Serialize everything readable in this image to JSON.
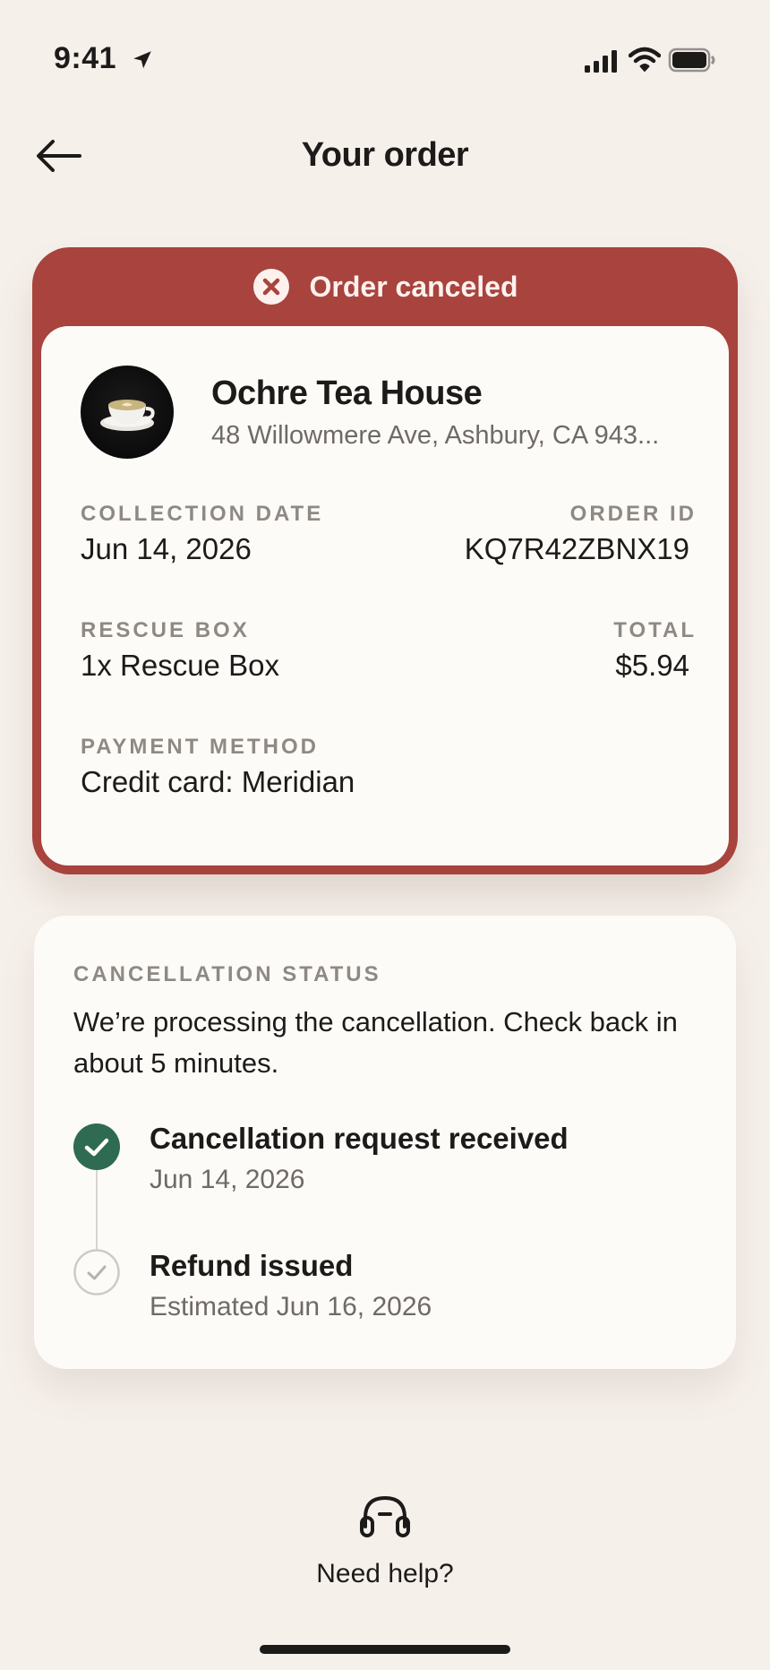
{
  "status_bar": {
    "time": "9:41",
    "icons": [
      "location-arrow-icon",
      "cellular-signal-icon",
      "wifi-icon",
      "battery-icon"
    ]
  },
  "header": {
    "title": "Your order",
    "back_icon": "arrow-left-icon"
  },
  "order": {
    "banner": {
      "icon": "x-circle-icon",
      "text": "Order canceled",
      "color": "#a8433d"
    },
    "store": {
      "name": "Ochre Tea House",
      "address": "48 Willowmere Ave, Ashbury, CA 943..."
    },
    "collection_date": {
      "label": "COLLECTION DATE",
      "value": "Jun 14, 2026"
    },
    "order_id": {
      "label": "ORDER ID",
      "value": "KQ7R42ZBNX19"
    },
    "rescue_box": {
      "label": "RESCUE BOX",
      "value": "1x Rescue Box"
    },
    "total": {
      "label": "TOTAL",
      "value": "$5.94"
    },
    "payment_method": {
      "label": "PAYMENT METHOD",
      "value": "Credit card: Meridian"
    }
  },
  "cancellation": {
    "label": "CANCELLATION STATUS",
    "message": "We’re processing the cancellation. Check back in about 5 minutes.",
    "steps": [
      {
        "title": "Cancellation request received",
        "subtitle": "Jun 14, 2026",
        "status": "done",
        "color": "#2e6b52"
      },
      {
        "title": "Refund issued",
        "subtitle": "Estimated Jun 16, 2026",
        "status": "pending"
      }
    ]
  },
  "help": {
    "icon": "headset-icon",
    "label": "Need help?"
  }
}
